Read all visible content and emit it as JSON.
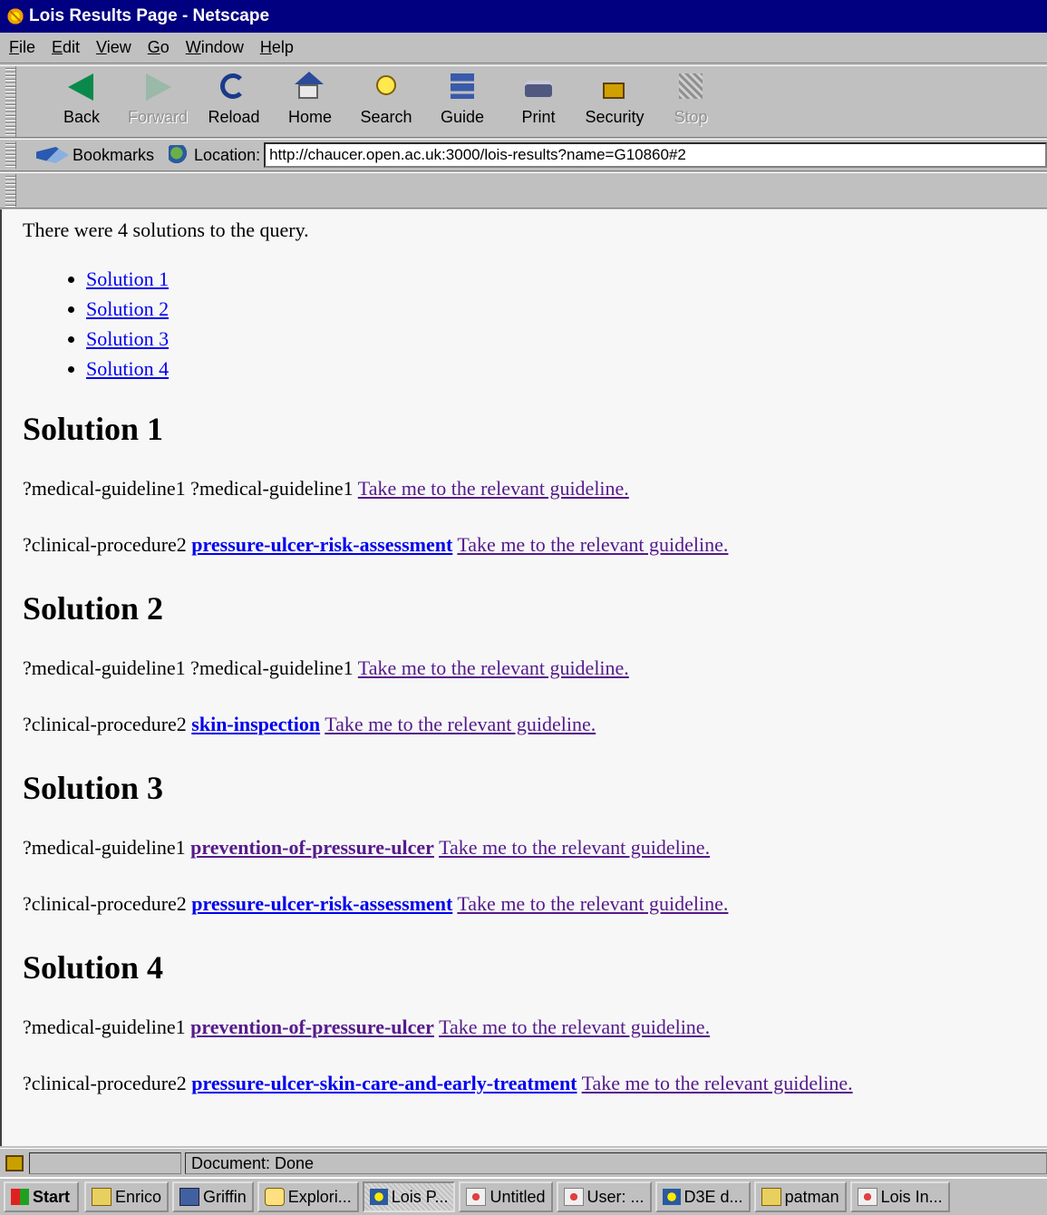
{
  "window": {
    "title": "Lois Results Page - Netscape"
  },
  "menu": [
    {
      "label": "File",
      "ul": "F",
      "rest": "ile"
    },
    {
      "label": "Edit",
      "ul": "E",
      "rest": "dit"
    },
    {
      "label": "View",
      "ul": "V",
      "rest": "iew"
    },
    {
      "label": "Go",
      "ul": "G",
      "rest": "o"
    },
    {
      "label": "Window",
      "ul": "W",
      "rest": "indow"
    },
    {
      "label": "Help",
      "ul": "H",
      "rest": "elp"
    }
  ],
  "toolbar": {
    "back": "Back",
    "forward": "Forward",
    "reload": "Reload",
    "home": "Home",
    "search": "Search",
    "guide": "Guide",
    "print": "Print",
    "security": "Security",
    "stop": "Stop"
  },
  "location": {
    "bookmarks_label": "Bookmarks",
    "label": "Location:",
    "url": "http://chaucer.open.ac.uk:3000/lois-results?name=G10860#2"
  },
  "content": {
    "intro": "There were 4 solutions to the query.",
    "solution_links": [
      "Solution 1",
      "Solution 2",
      "Solution 3",
      "Solution 4"
    ],
    "guideline_link": "Take me to the relevant guideline.",
    "solutions": [
      {
        "heading": "Solution 1",
        "row1": {
          "var": "?medical-guideline1",
          "value": "?medical-guideline1",
          "value_is_link": false
        },
        "row2": {
          "var": "?clinical-procedure2",
          "value": "pressure-ulcer-risk-assessment",
          "value_is_link": true
        }
      },
      {
        "heading": "Solution 2",
        "row1": {
          "var": "?medical-guideline1",
          "value": "?medical-guideline1",
          "value_is_link": false
        },
        "row2": {
          "var": "?clinical-procedure2",
          "value": "skin-inspection",
          "value_is_link": true
        }
      },
      {
        "heading": "Solution 3",
        "row1": {
          "var": "?medical-guideline1",
          "value": "prevention-of-pressure-ulcer",
          "value_is_link": true
        },
        "row2": {
          "var": "?clinical-procedure2",
          "value": "pressure-ulcer-risk-assessment",
          "value_is_link": true
        }
      },
      {
        "heading": "Solution 4",
        "row1": {
          "var": "?medical-guideline1",
          "value": "prevention-of-pressure-ulcer",
          "value_is_link": true
        },
        "row2": {
          "var": "?clinical-procedure2",
          "value": "pressure-ulcer-skin-care-and-early-treatment",
          "value_is_link": true
        }
      }
    ]
  },
  "status": {
    "text": "Document: Done"
  },
  "taskbar": {
    "start": "Start",
    "tasks": [
      {
        "label": "Enrico",
        "icon": "folder-icon",
        "active": false
      },
      {
        "label": "Griffin",
        "icon": "computer-icon",
        "active": false
      },
      {
        "label": "Explori...",
        "icon": "explore-icon",
        "active": false
      },
      {
        "label": "Lois P...",
        "icon": "netscape-icon",
        "active": true
      },
      {
        "label": "Untitled",
        "icon": "document-icon",
        "active": false
      },
      {
        "label": "User: ...",
        "icon": "document-icon",
        "active": false
      },
      {
        "label": "D3E d...",
        "icon": "netscape-icon",
        "active": false
      },
      {
        "label": "patman",
        "icon": "folder-icon",
        "active": false
      },
      {
        "label": "Lois In...",
        "icon": "document-icon",
        "active": false
      }
    ]
  },
  "colors": {
    "link": "#0000ee",
    "visited_link": "#551a8b",
    "titlebar": "#000080"
  }
}
